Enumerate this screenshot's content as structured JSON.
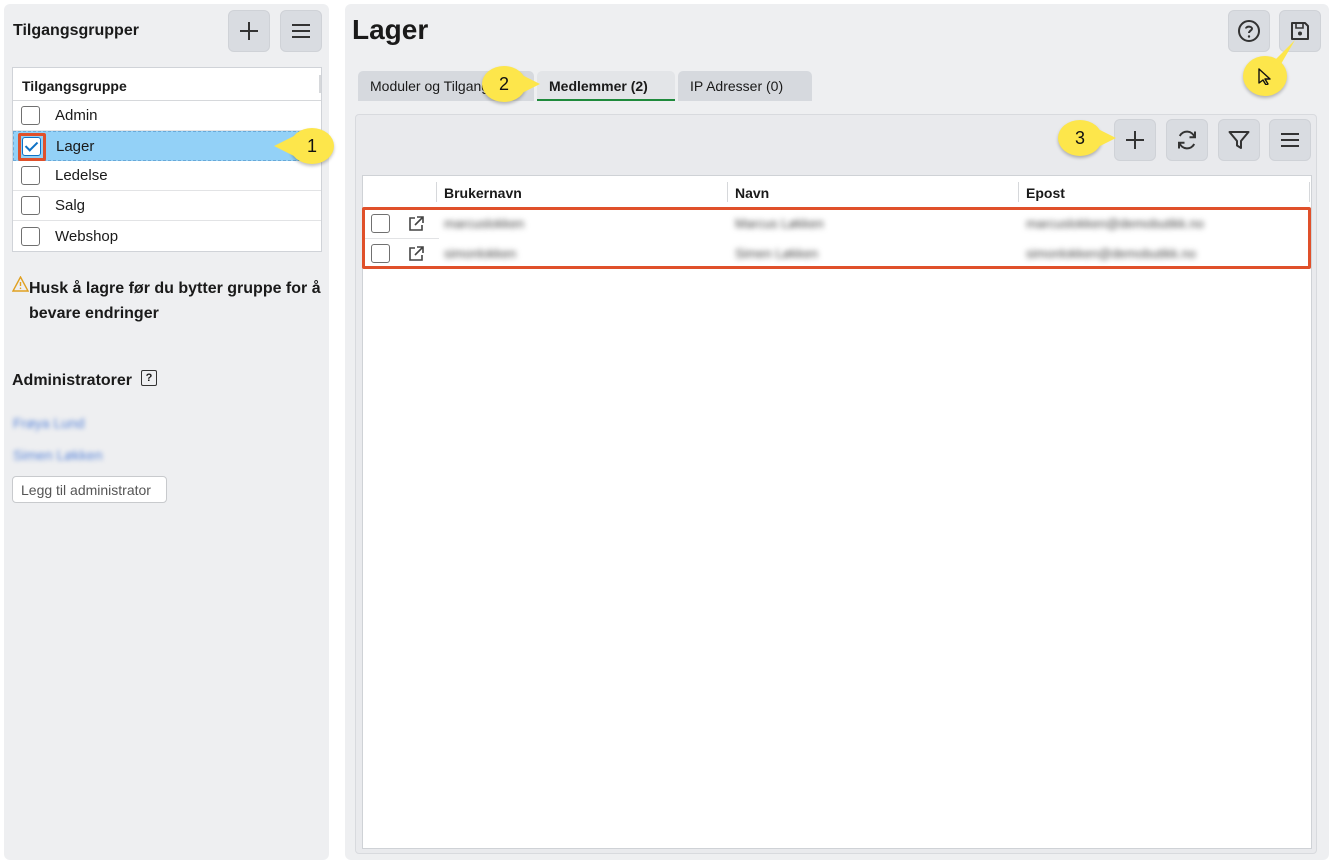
{
  "left": {
    "title": "Tilgangsgrupper",
    "grid_header": "Tilgangsgruppe",
    "groups": [
      {
        "label": "Admin",
        "checked": false
      },
      {
        "label": "Lager",
        "checked": true
      },
      {
        "label": "Ledelse",
        "checked": false
      },
      {
        "label": "Salg",
        "checked": false
      },
      {
        "label": "Webshop",
        "checked": false
      }
    ],
    "warning": "Husk å lagre før du bytter gruppe for å bevare endringer",
    "admins_title": "Administratorer",
    "admins_help": "?",
    "admins": [
      "Frøya Lund",
      "Simen Løkken"
    ],
    "add_admin_placeholder": "Legg til administrator"
  },
  "main": {
    "title": "Lager",
    "tabs": [
      {
        "label": "Moduler og Tilgang",
        "active": false
      },
      {
        "label": "Medlemmer (2)",
        "active": true
      },
      {
        "label": "IP Adresser (0)",
        "active": false
      }
    ],
    "columns": [
      "Brukernavn",
      "Navn",
      "Epost"
    ],
    "members": [
      {
        "username": "marcuslokken",
        "name": "Marcus Løkken",
        "email": "marcuslokken@demobutikk.no"
      },
      {
        "username": "simonlokken",
        "name": "Simen Løkken",
        "email": "simonlokken@demobutikk.no"
      }
    ]
  },
  "callouts": [
    "1",
    "2",
    "3"
  ],
  "icons": {
    "add": "plus-icon",
    "menu": "menu-icon",
    "help": "help-icon",
    "save": "save-icon",
    "refresh": "refresh-icon",
    "filter": "filter-icon",
    "open": "external-link-icon",
    "warning": "warning-icon"
  },
  "colors": {
    "selection": "#93d1f7",
    "highlight": "#e0502a",
    "callout": "#fde64b",
    "active_tab_underline": "#1f8a3c"
  }
}
